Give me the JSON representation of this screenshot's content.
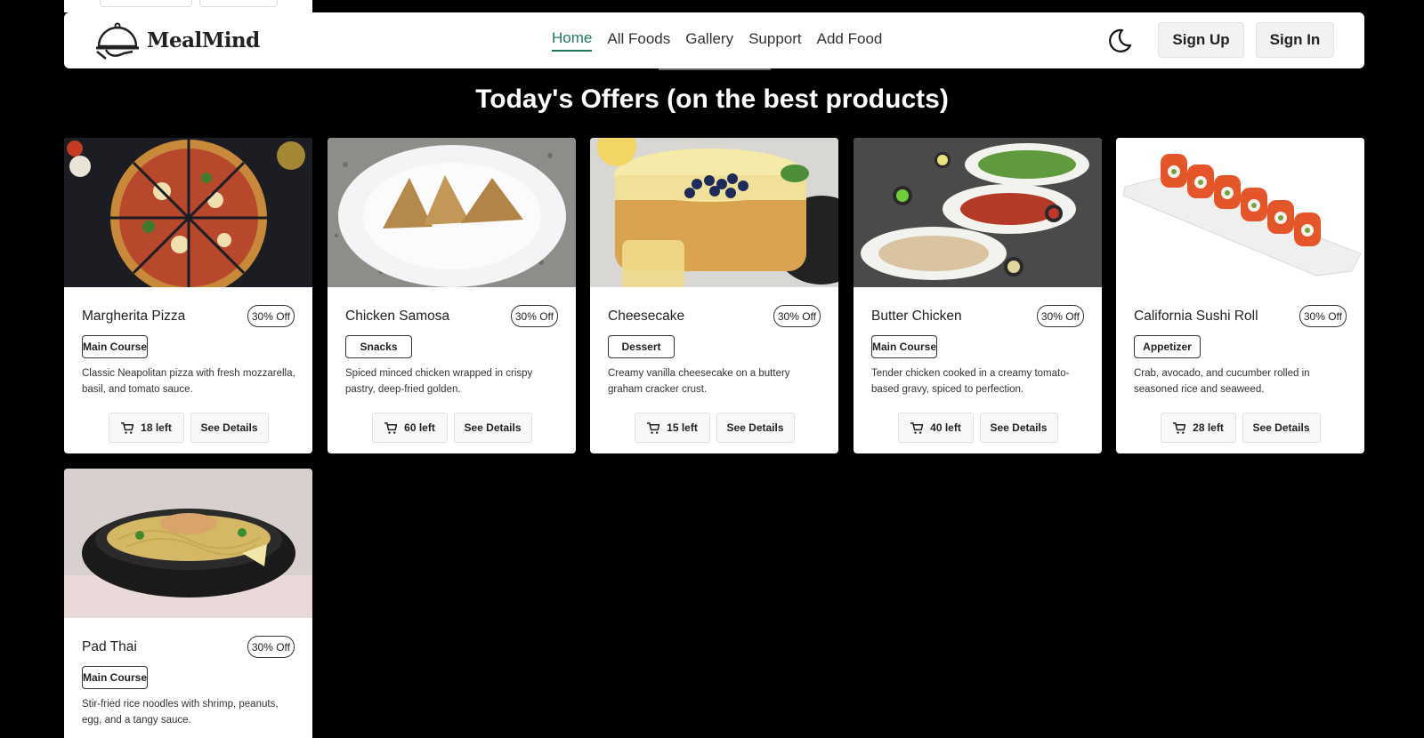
{
  "brand": {
    "name": "MealMind"
  },
  "nav": {
    "links": [
      {
        "label": "Home",
        "active": true
      },
      {
        "label": "All Foods",
        "active": false
      },
      {
        "label": "Gallery",
        "active": false
      },
      {
        "label": "Support",
        "active": false
      },
      {
        "label": "Add Food",
        "active": false
      }
    ],
    "signup_label": "Sign Up",
    "signin_label": "Sign In"
  },
  "heading": "Today's Offers (on the best products)",
  "colors": {
    "accent": "#1f7a57",
    "background": "#000000"
  },
  "cards": [
    {
      "title": "Margherita Pizza",
      "badge": "30% Off",
      "category": "Main Course",
      "description": "Classic Neapolitan pizza with fresh mozzarella, basil, and tomato sauce.",
      "stock": "18 left",
      "details_label": "See Details"
    },
    {
      "title": "Chicken Samosa",
      "badge": "30% Off",
      "category": "Snacks",
      "description": "Spiced minced chicken wrapped in crispy pastry, deep-fried golden.",
      "stock": "60 left",
      "details_label": "See Details"
    },
    {
      "title": "Cheesecake",
      "badge": "30% Off",
      "category": "Dessert",
      "description": "Creamy vanilla cheesecake on a buttery graham cracker crust.",
      "stock": "15 left",
      "details_label": "See Details"
    },
    {
      "title": "Butter Chicken",
      "badge": "30% Off",
      "category": "Main Course",
      "description": "Tender chicken cooked in a creamy tomato-based gravy, spiced to perfection.",
      "stock": "40 left",
      "details_label": "See Details"
    },
    {
      "title": "California Sushi Roll",
      "badge": "30% Off",
      "category": "Appetizer",
      "description": "Crab, avocado, and cucumber rolled in seasoned rice and seaweed.",
      "stock": "28 left",
      "details_label": "See Details"
    },
    {
      "title": "Pad Thai",
      "badge": "30% Off",
      "category": "Main Course",
      "description": "Stir-fried rice noodles with shrimp, peanuts, egg, and a tangy sauce.",
      "stock": "",
      "details_label": ""
    }
  ]
}
